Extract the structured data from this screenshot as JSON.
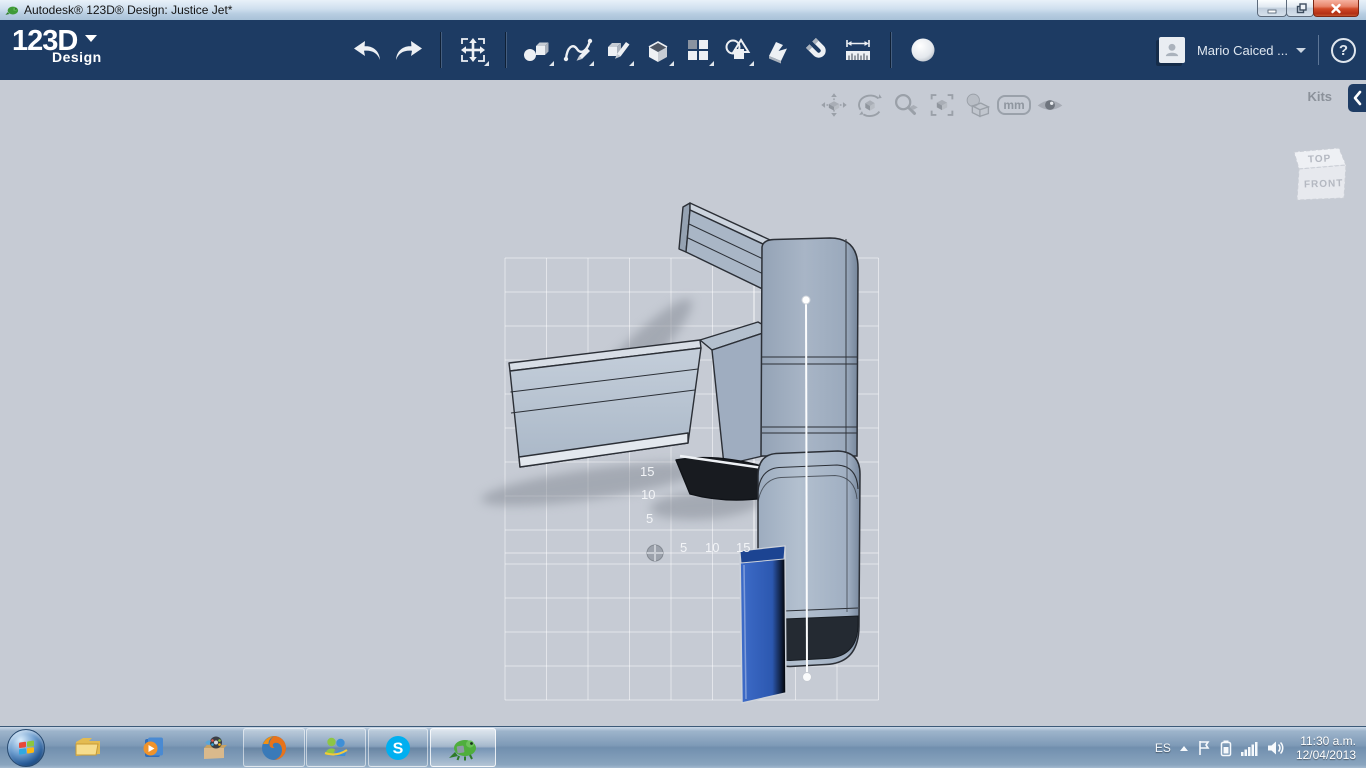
{
  "window": {
    "title": "Autodesk® 123D® Design: Justice Jet*"
  },
  "toolbar": {
    "brand": "123D",
    "brand_sub": "Design",
    "user_name": "Mario Caiced ...",
    "help_glyph": "?",
    "icons": [
      "undo",
      "redo",
      "transform-move",
      "primitives",
      "sketch",
      "modify",
      "construct",
      "pattern",
      "combine",
      "snap",
      "magnet",
      "measure",
      "material"
    ]
  },
  "viewport": {
    "kits_label": "Kits",
    "units_label": "mm",
    "nav_icons": [
      "pan",
      "orbit",
      "zoom",
      "zoom-fit",
      "material-shading",
      "units-mm",
      "visibility"
    ],
    "viewcube": {
      "top": "TOP",
      "front": "FRONT"
    },
    "axis": {
      "vertical_labels": [
        "15",
        "10",
        "5"
      ],
      "horizontal_labels": [
        "5",
        "10",
        "15"
      ]
    }
  },
  "taskbar": {
    "apps": [
      "start",
      "windows-explorer",
      "media-player",
      "app-box",
      "firefox",
      "messenger",
      "skype",
      "123d-design"
    ],
    "tray": {
      "language": "ES",
      "time": "11:30 a.m.",
      "date": "12/04/2013"
    }
  },
  "colors": {
    "toolbar_navy": "#1d3b63",
    "viewport_bg": "#c6cbd4",
    "model_gray": "#a2afc0",
    "model_blue": "#2e5cb5",
    "close_red": "#c13d1c"
  }
}
